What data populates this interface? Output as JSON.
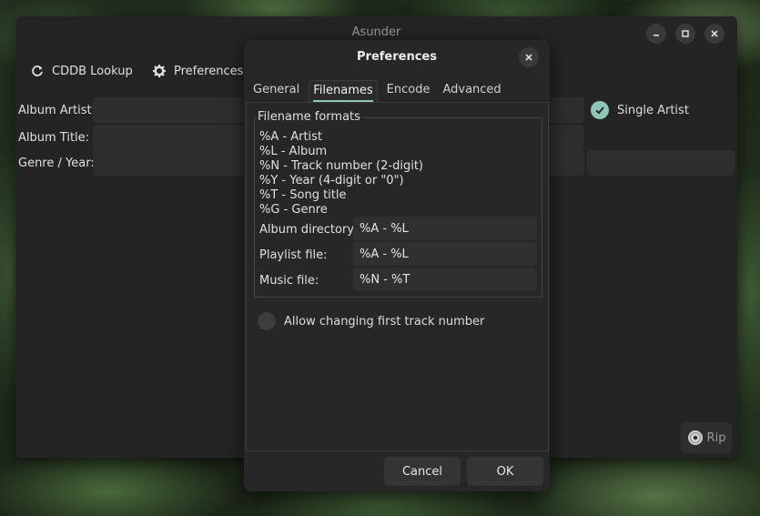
{
  "main_window": {
    "title": "Asunder",
    "toolbar": {
      "cddb_label": "CDDB Lookup",
      "preferences_label": "Preferences"
    },
    "fields": {
      "album_artist_label": "Album Artist:",
      "album_title_label": "Album Title:",
      "genre_year_label": "Genre / Year:"
    },
    "single_artist_label": "Single Artist",
    "single_artist_checked": true,
    "rip_label": "Rip"
  },
  "dialog": {
    "title": "Preferences",
    "tabs": [
      {
        "label": "General",
        "active": false
      },
      {
        "label": "Filenames",
        "active": true
      },
      {
        "label": "Encode",
        "active": false
      },
      {
        "label": "Advanced",
        "active": false
      }
    ],
    "frame_label": "Filename formats",
    "formats": [
      "%A - Artist",
      "%L - Album",
      "%N - Track number (2-digit)",
      "%Y - Year (4-digit or \"0\")",
      "%T - Song title",
      "%G - Genre"
    ],
    "album_directory": {
      "label": "Album directory:",
      "value": "%A - %L"
    },
    "playlist_file": {
      "label": "Playlist file:",
      "value": "%A - %L"
    },
    "music_file": {
      "label": "Music file:",
      "value": "%N - %T"
    },
    "allow_first_track_label": "Allow changing first track number",
    "allow_first_track_enabled": false,
    "cancel_label": "Cancel",
    "ok_label": "OK"
  },
  "colors": {
    "accent": "#8ec5b6",
    "window_bg": "#242424",
    "dialog_bg": "#272727"
  }
}
